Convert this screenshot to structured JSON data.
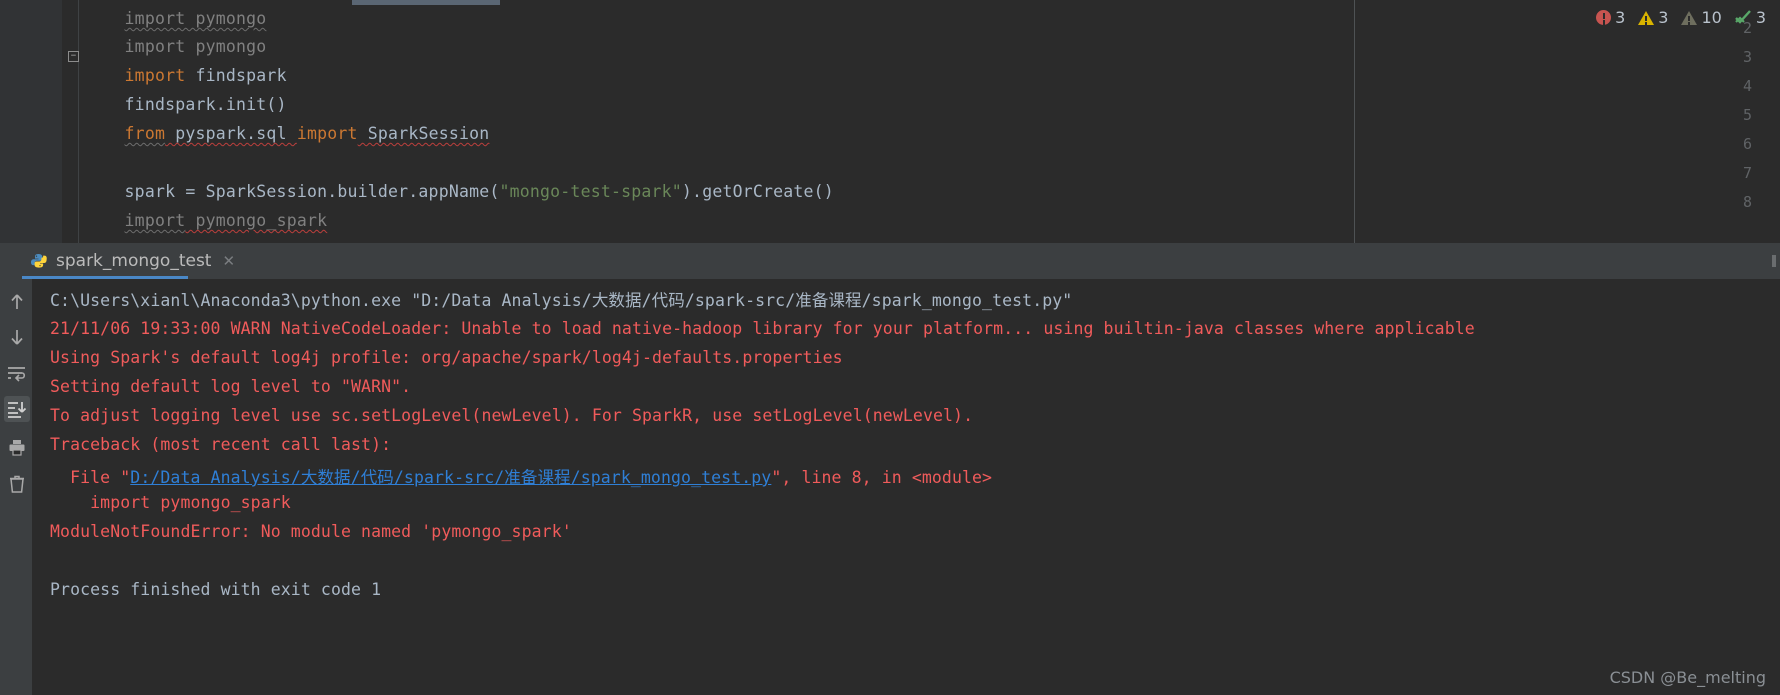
{
  "editor": {
    "lines": [
      {
        "num": "",
        "segments": []
      },
      {
        "num": "2",
        "text": "import pymongo"
      },
      {
        "num": "3",
        "text": "import findspark"
      },
      {
        "num": "4",
        "text": "findspark.init()"
      },
      {
        "num": "5",
        "text": "from pyspark.sql import SparkSession"
      },
      {
        "num": "6",
        "text": ""
      },
      {
        "num": "7",
        "text": "spark = SparkSession.builder.appName(\"mongo-test-spark\").getOrCreate()"
      },
      {
        "num": "8",
        "text": "import pymongo_spark"
      }
    ],
    "line1_num": "",
    "line2_num": "2",
    "line3_num": "3",
    "line4_num": "4",
    "line5_num": "5",
    "line6_num": "6",
    "line7_num": "7",
    "line8_num": "8",
    "l2_import": "import",
    "l2_mod": " pymongo",
    "l3_import": "import",
    "l3_mod": " findspark",
    "l4_text": "findspark.init()",
    "l5_from": "from",
    "l5_mod": " pyspark.sql ",
    "l5_import": "import",
    "l5_cls": " SparkSession",
    "l7_a": "spark = SparkSession.builder.appName(",
    "l7_str": "\"mongo-test-spark\"",
    "l7_b": ").getOrCreate()",
    "l8_import": "import",
    "l8_mod": " pymongo_spark",
    "fold_glyph": "−"
  },
  "inspection": {
    "errors": "3",
    "warnings": "3",
    "weak_warnings": "10",
    "ok": "3",
    "error_color": "#c75450",
    "warning_color": "#d9b400",
    "weak_color": "#6e6e5e",
    "ok_color": "#59a869"
  },
  "panel": {
    "tab_label": "spark_mongo_test",
    "tab_close": "✕",
    "accent_color": "#4a88c7"
  },
  "toolbar": {
    "rerun_up": "scroll-up",
    "rerun_down": "scroll-down",
    "soft_wrap": "soft-wrap",
    "scroll_end": "scroll-to-end",
    "print": "print",
    "clear": "clear-all"
  },
  "console": {
    "line1": "C:\\Users\\xianl\\Anaconda3\\python.exe \"D:/Data Analysis/大数据/代码/spark-src/准备课程/spark_mongo_test.py\"",
    "line2": "21/11/06 19:33:00 WARN NativeCodeLoader: Unable to load native-hadoop library for your platform... using builtin-java classes where applicable",
    "line3": "Using Spark's default log4j profile: org/apache/spark/log4j-defaults.properties",
    "line4": "Setting default log level to \"WARN\".",
    "line5": "To adjust logging level use sc.setLogLevel(newLevel). For SparkR, use setLogLevel(newLevel).",
    "line6": "Traceback (most recent call last):",
    "line7_pre": "  File \"",
    "line7_link": "D:/Data Analysis/大数据/代码/spark-src/准备课程/spark_mongo_test.py",
    "line7_post": "\", line 8, in <module>",
    "line8": "    import pymongo_spark",
    "line9": "ModuleNotFoundError: No module named 'pymongo_spark'",
    "line10": "",
    "line11": "Process finished with exit code 1"
  },
  "watermark": "CSDN @Be_melting"
}
